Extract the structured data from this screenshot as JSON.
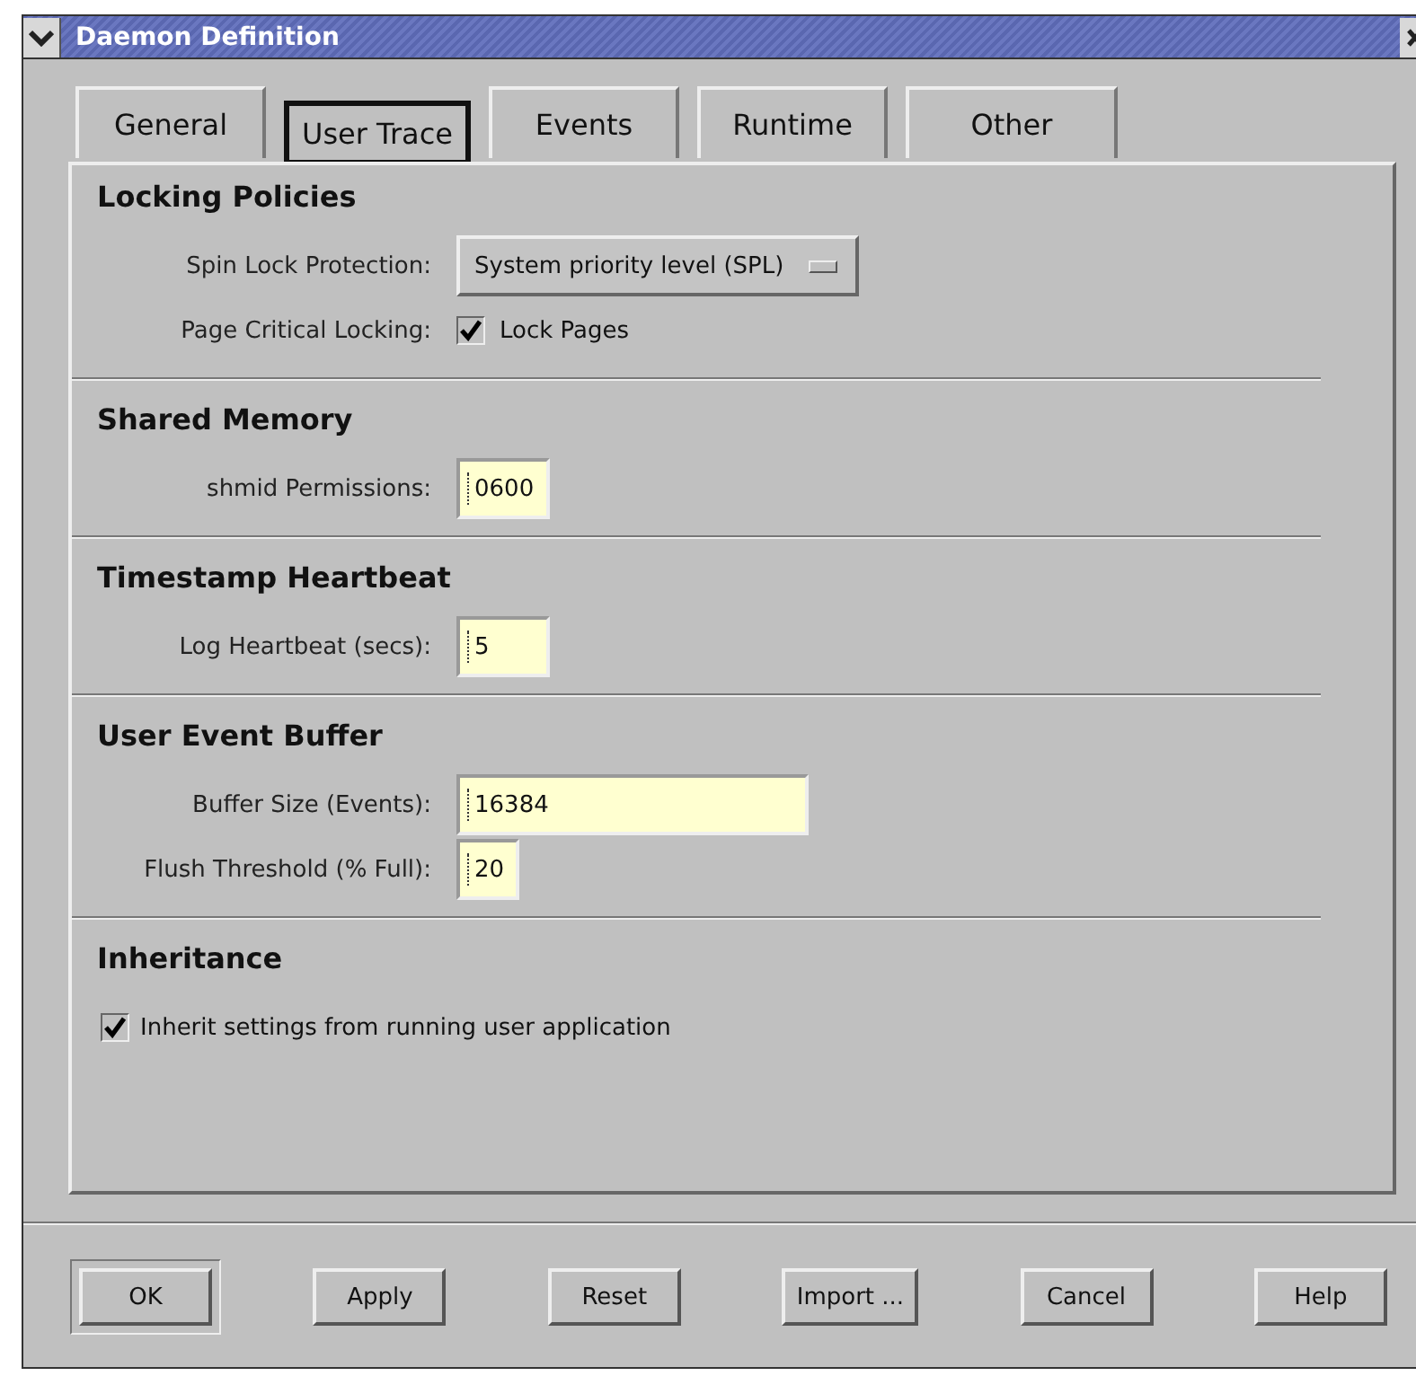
{
  "window": {
    "title": "Daemon Definition"
  },
  "tabs": [
    {
      "label": "General",
      "selected": false
    },
    {
      "label": "User Trace",
      "selected": true
    },
    {
      "label": "Events",
      "selected": false
    },
    {
      "label": "Runtime",
      "selected": false
    },
    {
      "label": "Other",
      "selected": false
    }
  ],
  "sections": [
    {
      "title": "Locking Policies",
      "rows": [
        {
          "kind": "select",
          "label": "Spin Lock Protection:",
          "value": "System priority level (SPL)"
        },
        {
          "kind": "checkbox",
          "label": "Page Critical Locking:",
          "option": "Lock Pages",
          "checked": true
        }
      ]
    },
    {
      "title": "Shared Memory",
      "rows": [
        {
          "kind": "field",
          "label": "shmid Permissions:",
          "value": "0600"
        }
      ]
    },
    {
      "title": "Timestamp Heartbeat",
      "rows": [
        {
          "kind": "field",
          "label": "Log Heartbeat (secs):",
          "value": "5"
        }
      ]
    },
    {
      "title": "User Event Buffer",
      "rows": [
        {
          "kind": "field",
          "label": "Buffer Size (Events):",
          "value": "16384"
        },
        {
          "kind": "field",
          "label": "Flush Threshold (% Full):",
          "value": "20"
        }
      ]
    },
    {
      "title": "Inheritance",
      "rows": [
        {
          "kind": "plaincheck",
          "option": "Inherit settings from running user application",
          "checked": true
        }
      ]
    }
  ],
  "buttons": [
    {
      "label": "OK",
      "default": true
    },
    {
      "label": "Apply",
      "default": false
    },
    {
      "label": "Reset",
      "default": false
    },
    {
      "label": "Import ...",
      "default": false
    },
    {
      "label": "Cancel",
      "default": false
    },
    {
      "label": "Help",
      "default": false
    }
  ]
}
